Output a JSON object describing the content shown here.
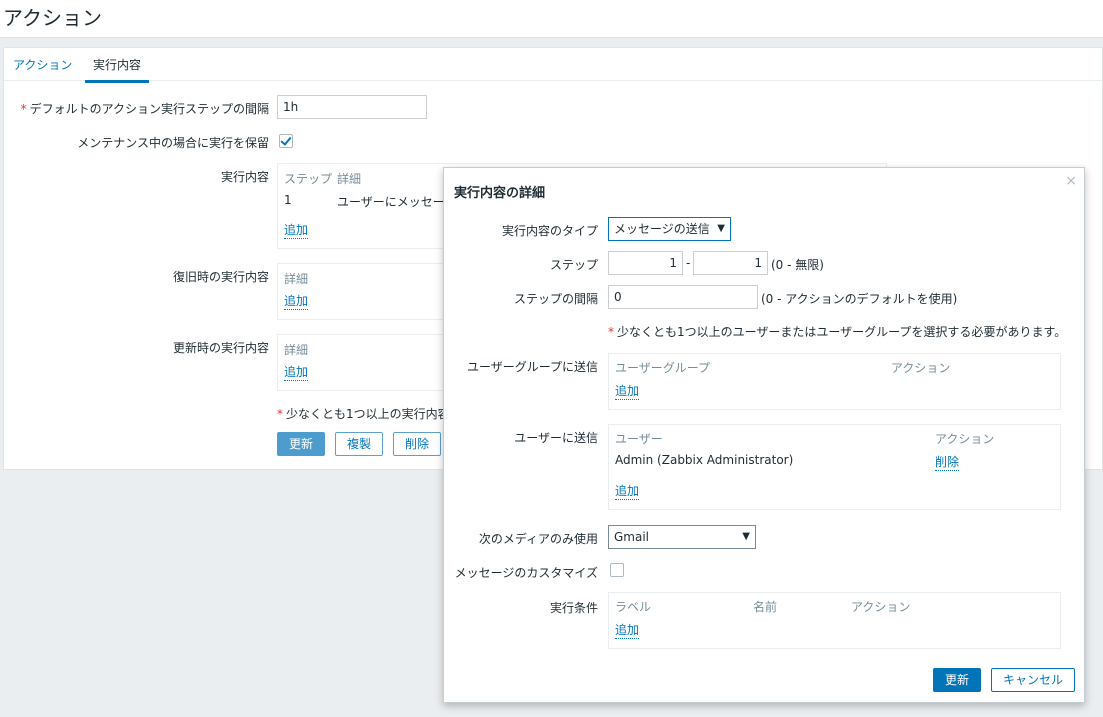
{
  "page": {
    "title": "アクション"
  },
  "tabs": [
    "アクション",
    "実行内容"
  ],
  "form": {
    "default_step_duration_label": "デフォルトのアクション実行ステップの間隔",
    "default_step_duration_value": "1h",
    "pause_maintenance_label": "メンテナンス中の場合に実行を保留",
    "pause_maintenance_checked": true,
    "operations_label": "実行内容",
    "operations_headers": {
      "step": "ステップ",
      "details": "詳細"
    },
    "operations_row": {
      "step": "1",
      "details": "ユーザーにメッセー"
    },
    "add_label": "追加",
    "recovery_label": "復旧時の実行内容",
    "recovery_details_header": "詳細",
    "update_ops_label": "更新時の実行内容",
    "update_details_header": "詳細",
    "warning": "少なくとも1つ以上の実行内容",
    "buttons": {
      "update": "更新",
      "clone": "複製",
      "delete": "削除"
    }
  },
  "dialog": {
    "title": "実行内容の詳細",
    "close_glyph": "×",
    "operation_type_label": "実行内容のタイプ",
    "operation_type_value": "メッセージの送信",
    "steps_label": "ステップ",
    "step_from": "1",
    "step_separator": "-",
    "step_to": "1",
    "step_hint": "(0 - 無限)",
    "step_duration_label": "ステップの間隔",
    "step_duration_value": "0",
    "step_duration_hint": "(0 - アクションのデフォルトを使用)",
    "warning": "少なくとも1つ以上のユーザーまたはユーザーグループを選択する必要があります。",
    "send_to_groups_label": "ユーザーグループに送信",
    "groups_headers": {
      "group": "ユーザーグループ",
      "action": "アクション"
    },
    "send_to_users_label": "ユーザーに送信",
    "users_headers": {
      "user": "ユーザー",
      "action": "アクション"
    },
    "user_row": {
      "name": "Admin (Zabbix Administrator)",
      "remove": "削除"
    },
    "media_label": "次のメディアのみ使用",
    "media_value": "Gmail",
    "custom_message_label": "メッセージのカスタマイズ",
    "custom_message_checked": false,
    "conditions_label": "実行条件",
    "conditions_headers": {
      "label": "ラベル",
      "name": "名前",
      "action": "アクション"
    },
    "add_label": "追加",
    "buttons": {
      "update": "更新",
      "cancel": "キャンセル"
    }
  },
  "colors": {
    "accent": "#0275b8",
    "required": "#e33734",
    "muted": "#768d99"
  }
}
